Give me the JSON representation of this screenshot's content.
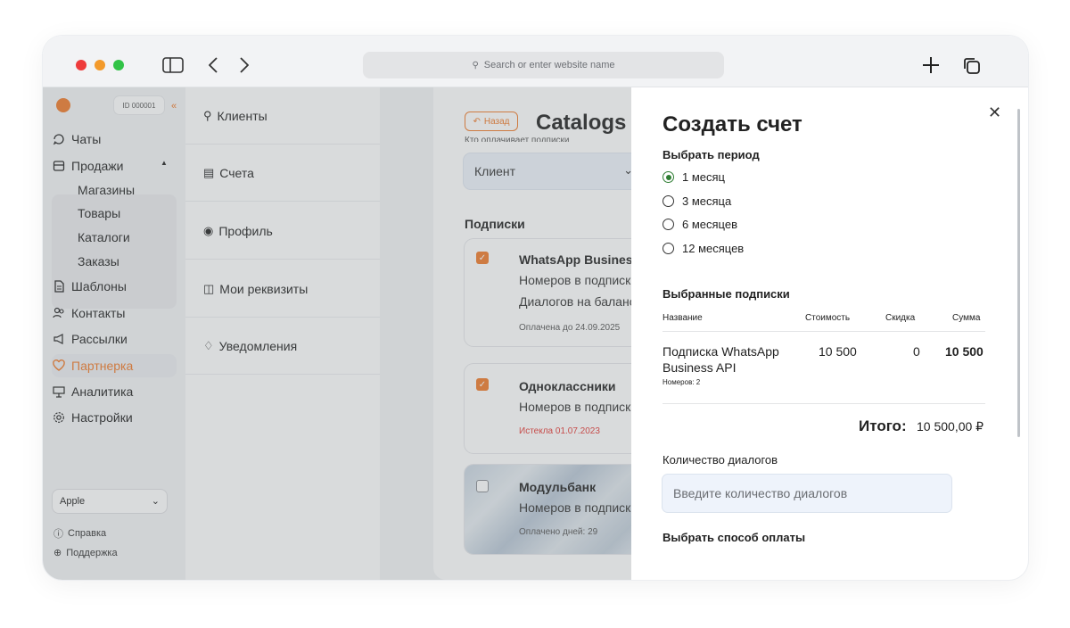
{
  "browser": {
    "address_placeholder": "Search or enter website name",
    "icons": [
      "sidebar-icon",
      "back-icon",
      "forward-icon",
      "plus-icon",
      "tabs-icon"
    ]
  },
  "sidebar": {
    "account_id": "ID 000001",
    "collapse_glyph": "«",
    "items": [
      {
        "label": "Чаты",
        "icon": "chat-icon"
      },
      {
        "label": "Продажи",
        "icon": "cart-icon"
      },
      {
        "label": "Шаблоны",
        "icon": "template-icon"
      },
      {
        "label": "Контакты",
        "icon": "contacts-icon"
      },
      {
        "label": "Рассылки",
        "icon": "megaphone-icon"
      },
      {
        "label": "Партнерка",
        "icon": "partner-icon",
        "active": true
      },
      {
        "label": "Аналитика",
        "icon": "analytics-icon"
      },
      {
        "label": "Настройки",
        "icon": "settings-icon"
      }
    ],
    "sales_sub": [
      "Магазины",
      "Товары",
      "Каталоги",
      "Заказы"
    ],
    "workspace_select": "Apple",
    "footer": [
      {
        "label": "Справка",
        "icon": "info-icon"
      },
      {
        "label": "Поддержка",
        "icon": "support-icon"
      }
    ],
    "accent_color": "#f07a2a"
  },
  "subnav": {
    "items": [
      {
        "label": "Клиенты",
        "icon": "user-icon"
      },
      {
        "label": "Счета",
        "icon": "invoice-icon"
      },
      {
        "label": "Профиль",
        "icon": "profile-icon"
      },
      {
        "label": "Мои реквизиты",
        "icon": "briefcase-icon"
      },
      {
        "label": "Уведомления",
        "icon": "bell-icon"
      }
    ]
  },
  "main": {
    "back_label": "Назад",
    "title": "Catalogs",
    "payer_label": "Кто оплачивает подписки",
    "payer_value": "Клиент",
    "subscriptions_title": "Подписки",
    "cards": [
      {
        "checked": true,
        "title": "WhatsApp Business",
        "line1": "Номеров в подписке",
        "line2": "Диалогов на балансе",
        "status": "Оплачена до 24.09.2025"
      },
      {
        "checked": true,
        "title": "Одноклассники",
        "line1": "Номеров в подписке",
        "status": "Истекла 01.07.2023",
        "status_color": "#e53935"
      },
      {
        "checked": false,
        "title": "Модульбанк",
        "line1": "Номеров в подписке",
        "status": "Оплачено дней: 29"
      }
    ]
  },
  "modal": {
    "title": "Создать счет",
    "period_title": "Выбрать период",
    "periods": [
      "1 месяц",
      "3 месяца",
      "6 месяцев",
      "12 месяцев"
    ],
    "selected_period": "1 месяц",
    "selected_subs_title": "Выбранные подписки",
    "table_headers": {
      "name": "Название",
      "cost": "Стоимость",
      "discount": "Скидка",
      "sum": "Сумма"
    },
    "row": {
      "name_line1": "Подписка WhatsApp",
      "name_line2": "Business API",
      "numbers": "Номеров: 2",
      "cost": "10 500",
      "discount": "0",
      "sum": "10 500"
    },
    "total_label": "Итого:",
    "total_value": "10 500,00 ₽",
    "dialogs_label": "Количество диалогов",
    "dialogs_placeholder": "Введите количество диалогов",
    "payment_title": "Выбрать способ оплаты"
  }
}
